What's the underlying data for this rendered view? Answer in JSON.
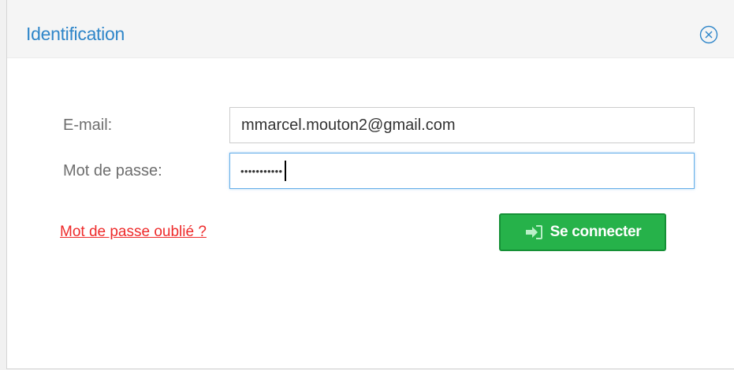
{
  "dialog": {
    "title": "Identification",
    "close_icon": "close-circle-icon"
  },
  "form": {
    "email_label": "E-mail:",
    "email_value": "mmarcel.mouton2@gmail.com",
    "password_label": "Mot de passe:",
    "password_value": "•••••••••••"
  },
  "actions": {
    "forgot_password": "Mot de passe oublié ?",
    "login_label": "Se connecter",
    "login_icon": "sign-in-icon"
  },
  "colors": {
    "title": "#2f86c9",
    "link": "#ee2a2a",
    "button_bg": "#26b24a",
    "focus_border": "#66afe9"
  }
}
